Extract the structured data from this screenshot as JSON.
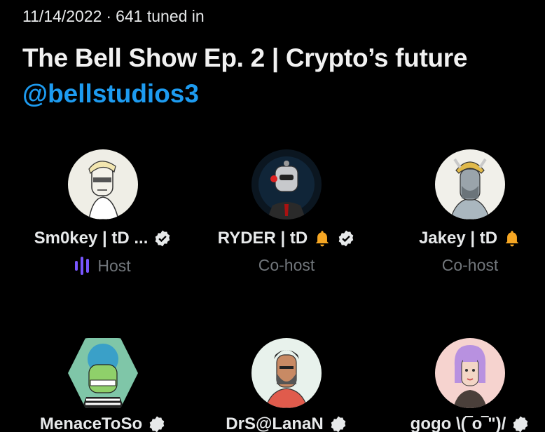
{
  "space": {
    "date": "11/14/2022",
    "separator": "·",
    "tuned_in": "641 tuned in",
    "title": "The Bell Show Ep. 2 | Crypto’s future",
    "host_handle": "@bellstudios3"
  },
  "speakers": [
    {
      "name": "Sm0key | tD ...",
      "role": "Host",
      "verified": true,
      "bell": false,
      "speaking": true
    },
    {
      "name": "RYDER | tD",
      "role": "Co-host",
      "verified": true,
      "bell": true,
      "speaking": false
    },
    {
      "name": "Jakey | tD",
      "role": "Co-host",
      "verified": false,
      "bell": true,
      "speaking": false
    },
    {
      "name": "MenaceToSo",
      "role": "",
      "verified": true
    },
    {
      "name": "DrS@LanaN",
      "role": "",
      "verified": true
    },
    {
      "name": "gogo  \\(‾o‾\")/",
      "role": "",
      "verified": true
    }
  ],
  "colors": {
    "background": "#000000",
    "accent": "#1d9bf0",
    "host_bars": "#7856ff",
    "role_text": "#71767b",
    "bell": "#f5a623"
  },
  "icons": {
    "verified": "verified-badge-icon",
    "bell": "bell-icon",
    "speaking": "speaking-bars-icon"
  }
}
